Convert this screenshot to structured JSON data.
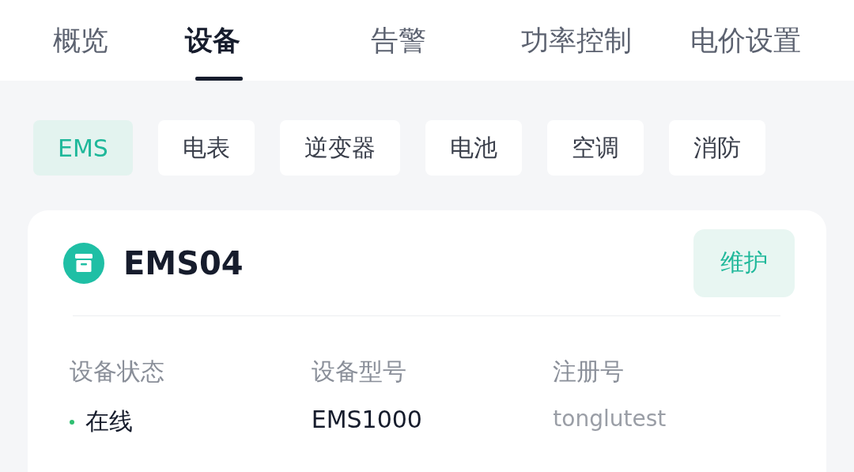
{
  "tabs": [
    {
      "label": "概览",
      "selected": false
    },
    {
      "label": "设备",
      "selected": true
    },
    {
      "label": "告警",
      "selected": false
    },
    {
      "label": "功率控制",
      "selected": false
    },
    {
      "label": "电价设置",
      "selected": false
    }
  ],
  "categories": [
    {
      "label": "EMS",
      "selected": true
    },
    {
      "label": "电表",
      "selected": false
    },
    {
      "label": "逆变器",
      "selected": false
    },
    {
      "label": "电池",
      "selected": false
    },
    {
      "label": "空调",
      "selected": false
    },
    {
      "label": "消防",
      "selected": false
    }
  ],
  "device": {
    "name": "EMS04",
    "action": "维护",
    "fields": [
      {
        "label": "设备状态",
        "value": "在线",
        "kind": "status",
        "online": true
      },
      {
        "label": "设备型号",
        "value": "EMS1000",
        "kind": "text"
      },
      {
        "label": "注册号",
        "value": "tonglutest",
        "kind": "masked"
      }
    ]
  }
}
